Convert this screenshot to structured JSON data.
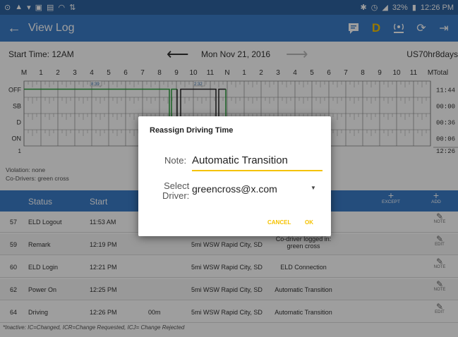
{
  "statusbar": {
    "left_icons": [
      "location-icon",
      "warning-icon",
      "download-icon",
      "image-icon",
      "sim-icon",
      "wifi-icon",
      "sync-icon"
    ],
    "battery": "32%",
    "time": "12:26 PM"
  },
  "appbar": {
    "title": "View Log",
    "icons": [
      "message-icon",
      "driver-status-d-icon",
      "eld-connection-icon",
      "refresh-icon",
      "logout-icon"
    ],
    "driver_status_letter": "D",
    "accent": "#3a7cc9",
    "status_bar_color": "#2e63a0"
  },
  "log": {
    "start_time": "Start Time: 12AM",
    "date": "Mon Nov 21, 2016",
    "cycle": "US70hr8days",
    "grid_rows": [
      "OFF",
      "SB",
      "D",
      "ON"
    ],
    "hour_labels": [
      "M",
      "1",
      "2",
      "3",
      "4",
      "5",
      "6",
      "7",
      "8",
      "9",
      "10",
      "11",
      "N",
      "1",
      "2",
      "3",
      "4",
      "5",
      "6",
      "7",
      "8",
      "9",
      "10",
      "11",
      "M"
    ],
    "total_label": "Total",
    "totals": [
      "11:44",
      "00:00",
      "00:36",
      "00:06",
      "12:26"
    ],
    "event_markers": [
      "8:39",
      "2:32"
    ],
    "violation": "Violation: none",
    "codrivers": "Co-Drivers: green cross"
  },
  "table": {
    "headers": {
      "status": "Status",
      "start": "Start"
    },
    "except_label": "EXCEPT",
    "add_label": "ADD",
    "rows": [
      {
        "num": "57",
        "status": "ELD Logout",
        "start": "11:53 AM",
        "duration": "",
        "location": "",
        "note": "",
        "action": "NOTE"
      },
      {
        "num": "59",
        "status": "Remark",
        "start": "12:19 PM",
        "duration": "",
        "location": "5mi WSW Rapid City, SD",
        "note": "Co-driver logged in: green cross",
        "action": "EDIT"
      },
      {
        "num": "60",
        "status": "ELD Login",
        "start": "12:21 PM",
        "duration": "",
        "location": "5mi WSW Rapid City, SD",
        "note": "ELD Connection",
        "action": "NOTE"
      },
      {
        "num": "62",
        "status": "Power On",
        "start": "12:25 PM",
        "duration": "",
        "location": "5mi WSW Rapid City, SD",
        "note": "Automatic Transition",
        "action": "NOTE"
      },
      {
        "num": "64",
        "status": "Driving",
        "start": "12:26 PM",
        "duration": "00m",
        "location": "5mi WSW Rapid City, SD",
        "note": "Automatic Transition",
        "action": "EDIT"
      }
    ],
    "footer": "*Inactive: IC=Changed, ICR=Change Requested, ICJ= Change Rejected"
  },
  "dialog": {
    "title": "Reassign Driving Time",
    "note_label": "Note:",
    "note_value": "Automatic Transition",
    "select_label": "Select Driver:",
    "select_label_line1": "Select",
    "select_label_line2": "Driver:",
    "selected_driver": "greencross@x.com",
    "cancel_label": "CANCEL",
    "ok_label": "OK",
    "button_color": "#f5c200"
  }
}
